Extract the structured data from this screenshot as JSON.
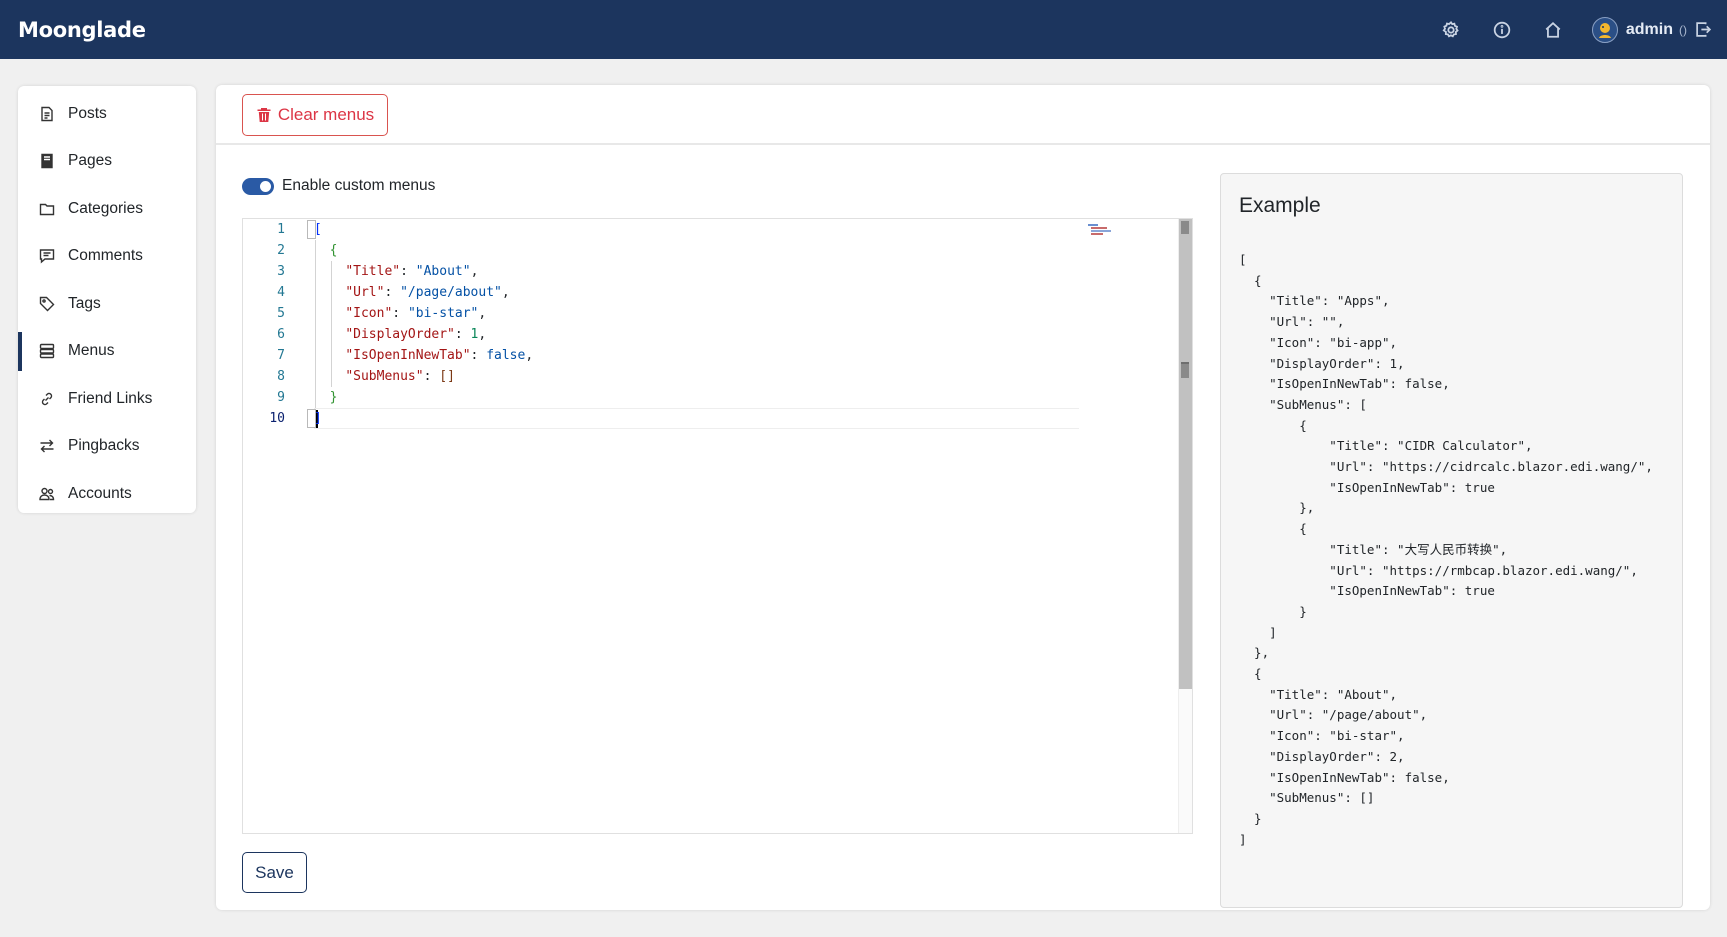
{
  "brand": "Moonglade",
  "topbar": {
    "icons": [
      "gear-icon",
      "info-icon",
      "home-icon"
    ],
    "user_name": "admin",
    "user_extra": "()",
    "logout_icon": "logout-icon"
  },
  "sidebar": {
    "items": [
      {
        "label": "Posts",
        "icon": "file-text-icon"
      },
      {
        "label": "Pages",
        "icon": "file-icon"
      },
      {
        "label": "Categories",
        "icon": "folder-icon"
      },
      {
        "label": "Comments",
        "icon": "chat-icon"
      },
      {
        "label": "Tags",
        "icon": "tag-icon"
      },
      {
        "label": "Menus",
        "icon": "menu-icon",
        "active": true
      },
      {
        "label": "Friend Links",
        "icon": "link-icon"
      },
      {
        "label": "Pingbacks",
        "icon": "arrows-icon"
      },
      {
        "label": "Accounts",
        "icon": "people-icon"
      }
    ]
  },
  "main": {
    "clear_button": "Clear menus",
    "toggle_label": "Enable custom menus",
    "toggle_on": true,
    "save_button": "Save",
    "editor": {
      "line_numbers": [
        "1",
        "2",
        "3",
        "4",
        "5",
        "6",
        "7",
        "8",
        "9",
        "10"
      ],
      "lines": [
        "[",
        "  {",
        "    \"Title\": \"About\",",
        "    \"Url\": \"/page/about\",",
        "    \"Icon\": \"bi-star\",",
        "    \"DisplayOrder\": 1,",
        "    \"IsOpenInNewTab\": false,",
        "    \"SubMenus\": []",
        "  }",
        "]"
      ],
      "cursor_line": 10
    }
  },
  "example": {
    "title": "Example",
    "code": "[\n  {\n    \"Title\": \"Apps\",\n    \"Url\": \"\",\n    \"Icon\": \"bi-app\",\n    \"DisplayOrder\": 1,\n    \"IsOpenInNewTab\": false,\n    \"SubMenus\": [\n        {\n            \"Title\": \"CIDR Calculator\",\n            \"Url\": \"https://cidrcalc.blazor.edi.wang/\",\n            \"IsOpenInNewTab\": true\n        },\n        {\n            \"Title\": \"大写人民币转换\",\n            \"Url\": \"https://rmbcap.blazor.edi.wang/\",\n            \"IsOpenInNewTab\": true\n        }\n    ]\n  },\n  {\n    \"Title\": \"About\",\n    \"Url\": \"/page/about\",\n    \"Icon\": \"bi-star\",\n    \"DisplayOrder\": 2,\n    \"IsOpenInNewTab\": false,\n    \"SubMenus\": []\n  }\n]"
  }
}
